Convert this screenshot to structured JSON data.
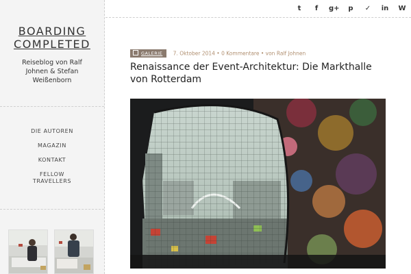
{
  "site": {
    "title_line1": "BOARDING",
    "title_line2": "COMPLETED",
    "description": "Reiseblog von Ralf Johnen & Stefan Weißenborn"
  },
  "nav": {
    "items": [
      {
        "label": "DIE AUTOREN"
      },
      {
        "label": "MAGAZIN"
      },
      {
        "label": "KONTAKT"
      },
      {
        "label": "FELLOW TRAVELLERS"
      }
    ]
  },
  "social": {
    "icons": [
      "twitter-icon",
      "facebook-icon",
      "google-plus-icon",
      "pinterest-icon",
      "delicious-icon",
      "linkedin-icon",
      "wordpress-icon"
    ],
    "glyphs": [
      "t",
      "f",
      "g+",
      "p",
      "✓",
      "in",
      "W"
    ]
  },
  "post": {
    "category": "GALERIE",
    "date": "7. Oktober 2014",
    "comments": "0 Kommentare",
    "author": "von Ralf Johnen",
    "title": "Renaissance der Event-Architektur: Die Markthalle von Rotterdam"
  },
  "colors": {
    "accent": "#b08f70",
    "badge": "#8a7a6e",
    "sidebar_bg": "#f4f4f4"
  }
}
